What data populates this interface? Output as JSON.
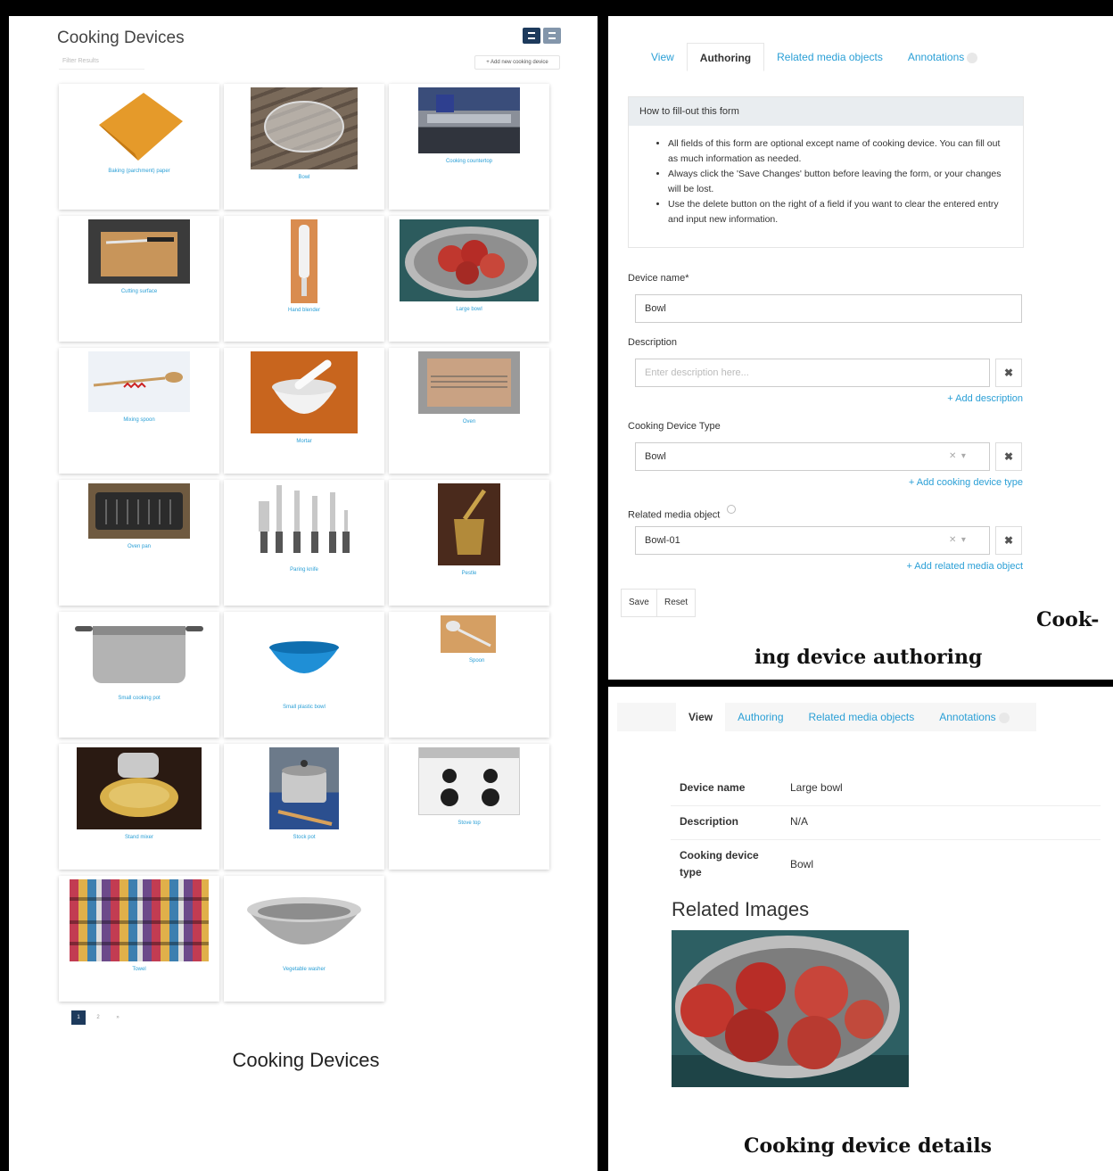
{
  "list": {
    "title": "Cooking Devices",
    "filter_placeholder": "Filter Results",
    "add_button": "+ Add new cooking device",
    "items": [
      "Baking (parchment) paper",
      "Bowl",
      "Cooking countertop",
      "Cutting surface",
      "Hand blender",
      "Large bowl",
      "Mixing spoon",
      "Mortar",
      "Oven",
      "Oven pan",
      "Paring knife",
      "Pestle",
      "Small cooking pot",
      "Small plastic bowl",
      "Spoon",
      "Stand mixer",
      "Stock pot",
      "Stove top",
      "Towel",
      "Vegetable washer"
    ],
    "pages": [
      "1",
      "2",
      "»"
    ],
    "caption": "Cooking Devices"
  },
  "authoring": {
    "tabs": [
      "View",
      "Authoring",
      "Related media objects",
      "Annotations"
    ],
    "help_title": "How to fill-out this form",
    "help_items": [
      "All fields of this form are optional except name of cooking device. You can fill out as much information as needed.",
      "Always click the 'Save Changes' button before leaving the form, or your changes will be lost.",
      "Use the delete button on the right of a field if you want to clear the entered entry and input new information."
    ],
    "device_name_label": "Device name*",
    "device_name_value": "Bowl",
    "description_label": "Description",
    "description_placeholder": "Enter description here...",
    "add_description": "+ Add description",
    "type_label": "Cooking Device Type",
    "type_value": "Bowl",
    "add_type": "+ Add cooking device type",
    "media_label": "Related media object",
    "media_value": "Bowl-01",
    "add_media": "+ Add related media object",
    "save": "Save",
    "reset": "Reset",
    "caption_line1": "Cook-",
    "caption_line2": "ing device authoring"
  },
  "details": {
    "tabs": [
      "View",
      "Authoring",
      "Related media objects",
      "Annotations"
    ],
    "rows": [
      {
        "key": "Device name",
        "value": "Large bowl"
      },
      {
        "key": "Description",
        "value": "N/A"
      },
      {
        "key": "Cooking device type",
        "value": "Bowl"
      }
    ],
    "related_title": "Related Images",
    "caption": "Cooking device details"
  },
  "colors": {
    "accent": "#2a9fd6",
    "dark_button": "#1d3a5c"
  }
}
